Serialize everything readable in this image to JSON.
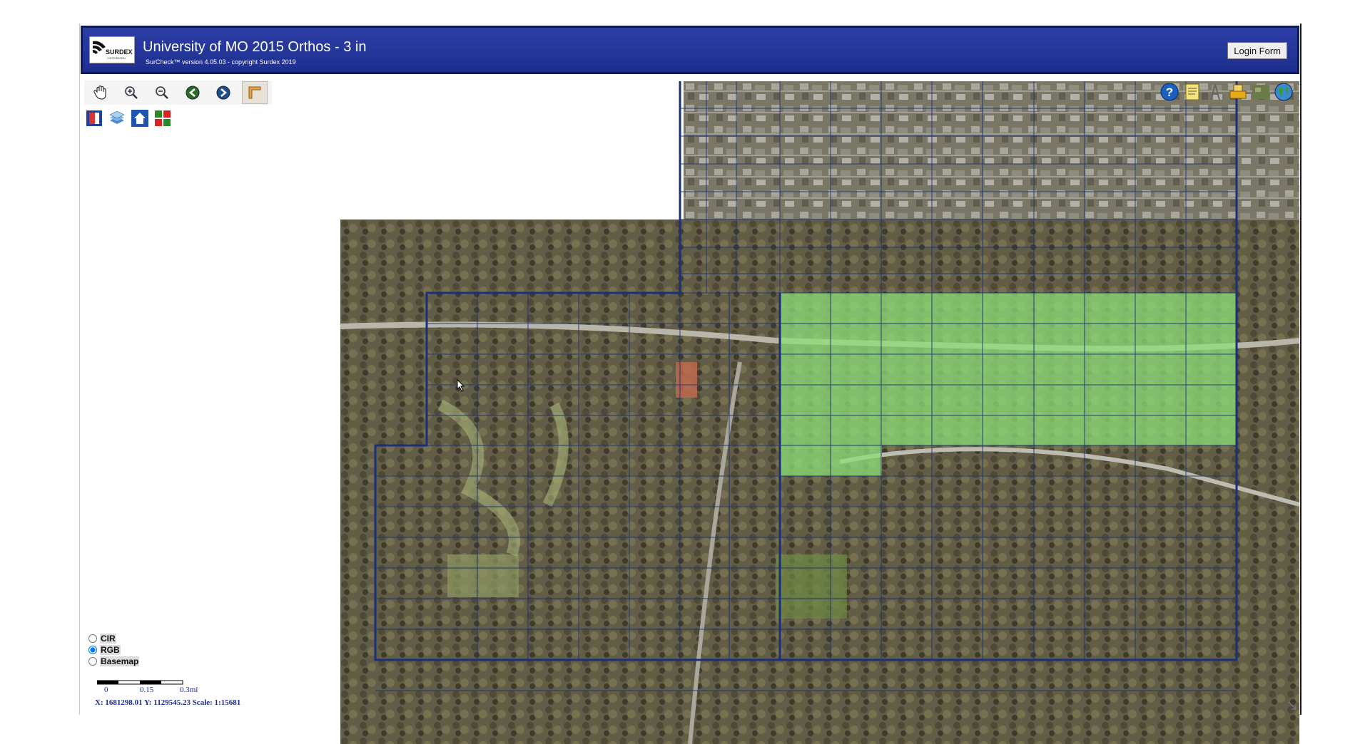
{
  "header": {
    "title": "University of MO 2015 Orthos - 3 in",
    "subtitle": "SurCheck™ version 4.05.03 - copyright Surdex 2019",
    "login_label": "Login Form",
    "logo_text": "SURDEX",
    "logo_tagline": "CORPORATION"
  },
  "toolbar": {
    "tools": [
      {
        "name": "pan-hand-icon"
      },
      {
        "name": "zoom-in-icon"
      },
      {
        "name": "zoom-out-icon"
      },
      {
        "name": "back-arrow-icon"
      },
      {
        "name": "forward-arrow-icon"
      },
      {
        "name": "measure-corner-icon"
      }
    ],
    "tools2": [
      {
        "name": "report-icon"
      },
      {
        "name": "layers-icon"
      },
      {
        "name": "home-icon"
      },
      {
        "name": "grid-icon"
      }
    ]
  },
  "right_tools": [
    {
      "name": "help-icon"
    },
    {
      "name": "notes-icon"
    },
    {
      "name": "draw-icon"
    },
    {
      "name": "print-icon"
    },
    {
      "name": "map-thumbnail-icon"
    },
    {
      "name": "globe-icon"
    }
  ],
  "layers": {
    "options": [
      {
        "label": "CIR",
        "checked": false
      },
      {
        "label": "RGB",
        "checked": true
      },
      {
        "label": "Basemap",
        "checked": false
      }
    ]
  },
  "scale": {
    "labels": [
      "0",
      "0.15",
      "0.3mi"
    ],
    "coords": "X: 1681298.01 Y: 1129545.23   Scale: 1:15681"
  },
  "colors": {
    "header_blue": "#2336a0",
    "grid_line": "#1b2f7a",
    "highlight_green": "#8ee07a"
  }
}
